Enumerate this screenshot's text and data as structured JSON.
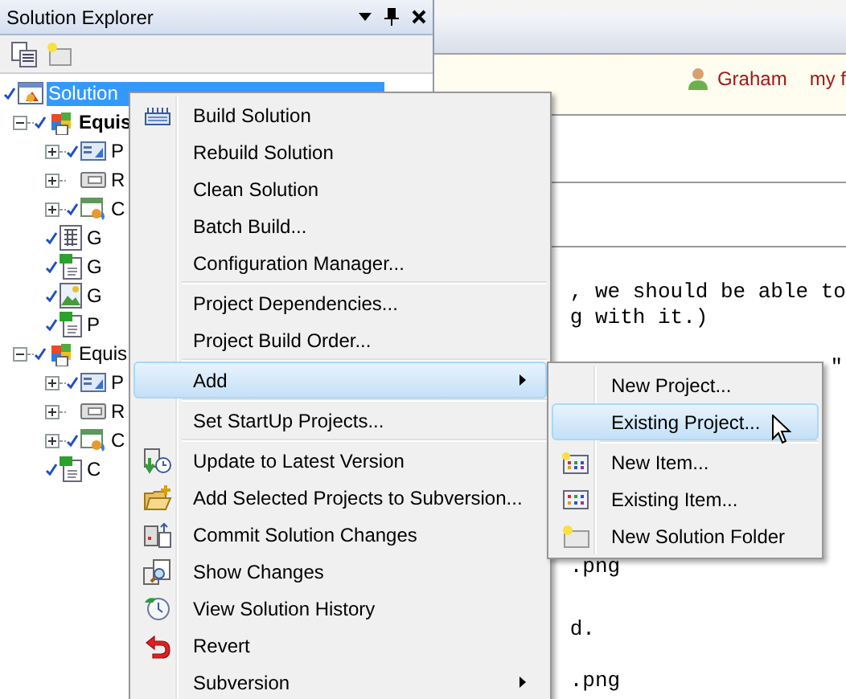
{
  "solution_explorer": {
    "title": "Solution Explorer",
    "tree": [
      {
        "label": "Solution",
        "kind": "solution",
        "selected": true,
        "checked": true,
        "children": [
          {
            "label": "Equis",
            "kind": "project",
            "bold": true,
            "expanded": true,
            "checked": true,
            "children": [
              {
                "label": "P",
                "kind": "properties",
                "expanded": false,
                "checked": true
              },
              {
                "label": "R",
                "kind": "references",
                "expanded": false,
                "checked": false
              },
              {
                "label": "C",
                "kind": "content",
                "expanded": false,
                "checked": true
              },
              {
                "label": "G",
                "kind": "grid",
                "checked": true
              },
              {
                "label": "G",
                "kind": "code",
                "checked": true
              },
              {
                "label": "G",
                "kind": "image",
                "checked": true
              },
              {
                "label": "P",
                "kind": "code",
                "checked": true
              }
            ]
          },
          {
            "label": "Equis",
            "kind": "project",
            "bold": false,
            "expanded": true,
            "checked": true,
            "children": [
              {
                "label": "P",
                "kind": "properties",
                "expanded": false,
                "checked": true
              },
              {
                "label": "R",
                "kind": "references",
                "expanded": false,
                "checked": false
              },
              {
                "label": "C",
                "kind": "content",
                "expanded": false,
                "checked": true
              },
              {
                "label": "C",
                "kind": "code",
                "checked": true
              }
            ]
          }
        ]
      }
    ]
  },
  "background_page": {
    "user": "Graham",
    "link": "my f",
    "lines": [
      ", we should be able to",
      "g with it.)",
      "\"",
      ".png",
      "d.",
      ".png"
    ]
  },
  "context_menu": {
    "items": [
      {
        "kind": "item",
        "label": "Build Solution",
        "selected": false,
        "submenu": false
      },
      {
        "kind": "item",
        "label": "Rebuild Solution",
        "selected": false,
        "submenu": false
      },
      {
        "kind": "item",
        "label": "Clean Solution",
        "selected": false,
        "submenu": false
      },
      {
        "kind": "item",
        "label": "Batch Build...",
        "selected": false,
        "submenu": false
      },
      {
        "kind": "item",
        "label": "Configuration Manager...",
        "selected": false,
        "submenu": false
      },
      {
        "kind": "separator"
      },
      {
        "kind": "item",
        "label": "Project Dependencies...",
        "selected": false,
        "submenu": false
      },
      {
        "kind": "item",
        "label": "Project Build Order...",
        "selected": false,
        "submenu": false
      },
      {
        "kind": "separator"
      },
      {
        "kind": "item",
        "label": "Add",
        "selected": true,
        "submenu": true
      },
      {
        "kind": "separator"
      },
      {
        "kind": "item",
        "label": "Set StartUp Projects...",
        "selected": false,
        "submenu": false
      },
      {
        "kind": "separator"
      },
      {
        "kind": "item",
        "label": "Update to Latest Version",
        "selected": false,
        "submenu": false
      },
      {
        "kind": "item",
        "label": "Add Selected Projects to Subversion...",
        "selected": false,
        "submenu": false
      },
      {
        "kind": "item",
        "label": "Commit Solution Changes",
        "selected": false,
        "submenu": false
      },
      {
        "kind": "item",
        "label": "Show Changes",
        "selected": false,
        "submenu": false
      },
      {
        "kind": "item",
        "label": "View Solution History",
        "selected": false,
        "submenu": false
      },
      {
        "kind": "item",
        "label": "Revert",
        "selected": false,
        "submenu": false
      },
      {
        "kind": "item",
        "label": "Subversion",
        "selected": false,
        "submenu": true
      }
    ]
  },
  "submenu": {
    "items": [
      {
        "kind": "item",
        "label": "New Project...",
        "selected": false,
        "submenu": false
      },
      {
        "kind": "item",
        "label": "Existing Project...",
        "selected": true,
        "submenu": false
      },
      {
        "kind": "separator"
      },
      {
        "kind": "item",
        "label": "New Item...",
        "selected": false,
        "submenu": false
      },
      {
        "kind": "item",
        "label": "Existing Item...",
        "selected": false,
        "submenu": false
      },
      {
        "kind": "item",
        "label": "New Solution Folder",
        "selected": false,
        "submenu": false
      }
    ]
  }
}
